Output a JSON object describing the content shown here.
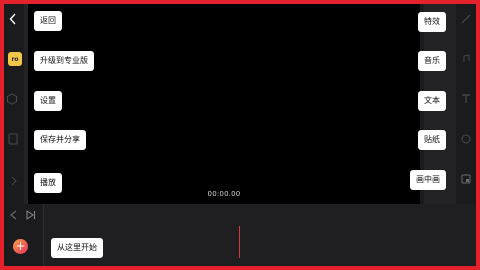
{
  "left_callouts": {
    "back": "返回",
    "upgrade": "升级到专业版",
    "settings": "设置",
    "save_share": "保存并分享",
    "play": "播放",
    "start_here": "从这里开始"
  },
  "right_callouts": {
    "effects": "特效",
    "music": "音乐",
    "text": "文本",
    "sticker": "贴纸",
    "pip": "画中画"
  },
  "preview": {
    "timecode": "00:00.00"
  },
  "badges": {
    "pro": "ro"
  },
  "colors": {
    "highlight_border": "#e3222d",
    "background": "#1b1b1d",
    "preview_bg": "#000000",
    "pro_badge": "#f3c646",
    "playhead": "#d9363e"
  }
}
